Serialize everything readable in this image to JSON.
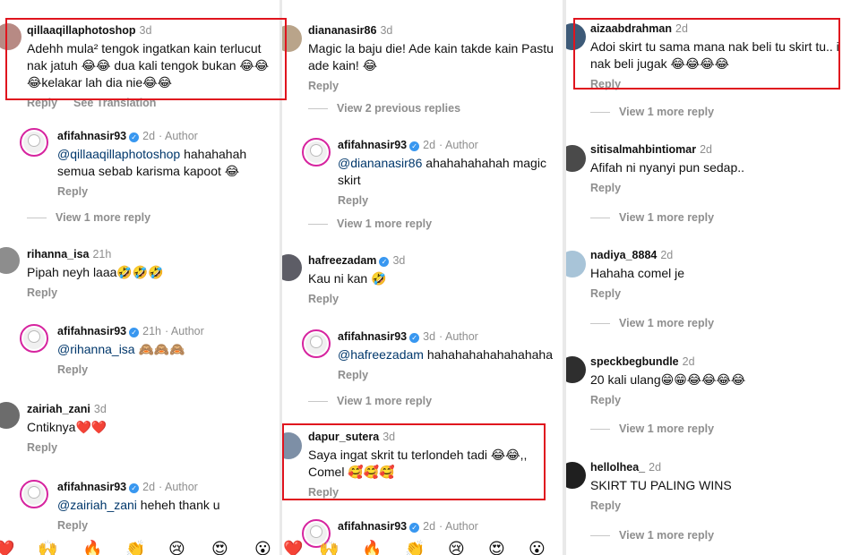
{
  "col1": {
    "c1": {
      "user": "qillaaqillaphotoshop",
      "ago": "3d",
      "text": "Adehh mula² tengok ingatkan kain terlucut nak jatuh 😂😂 dua kali tengok bukan 😂😂😂kelakar lah dia nie😂😂",
      "reply": "Reply",
      "translate": "See Translation"
    },
    "c2": {
      "user": "afifahnasir93",
      "ago": "2d",
      "author": "· Author",
      "mention": "@qillaaqillaphotoshop",
      "text": " hahahahah semua sebab karisma kapoot 😂",
      "reply": "Reply"
    },
    "more1": "View 1 more reply",
    "c3": {
      "user": "rihanna_isa",
      "ago": "21h",
      "text": "Pipah neyh laaa🤣🤣🤣",
      "reply": "Reply"
    },
    "c4": {
      "user": "afifahnasir93",
      "ago": "21h",
      "author": "· Author",
      "mention": "@rihanna_isa",
      "text": " 🙈🙈🙈",
      "reply": "Reply"
    },
    "c5": {
      "user": "zairiah_zani",
      "ago": "3d",
      "text": "Cntiknya❤️❤️",
      "reply": "Reply"
    },
    "c6": {
      "user": "afifahnasir93",
      "ago": "2d",
      "author": "· Author",
      "mention": "@zairiah_zani",
      "text": " heheh thank u",
      "reply": "Reply"
    }
  },
  "col2": {
    "c1": {
      "user": "diananasir86",
      "ago": "3d",
      "text": "Magic la baju die! Ade kain takde kain Pastu ade kain! 😂",
      "reply": "Reply"
    },
    "more0": "View 2 previous replies",
    "c2": {
      "user": "afifahnasir93",
      "ago": "2d",
      "author": "· Author",
      "mention": "@diananasir86",
      "text": " ahahahahahah magic skirt",
      "reply": "Reply"
    },
    "more1": "View 1 more reply",
    "c3": {
      "user": "hafreezadam",
      "ago": "3d",
      "text": "Kau ni kan 🤣",
      "reply": "Reply"
    },
    "c4": {
      "user": "afifahnasir93",
      "ago": "3d",
      "author": "· Author",
      "mention": "@hafreezadam",
      "text": " hahahahahahahahaha",
      "reply": "Reply"
    },
    "more2": "View 1 more reply",
    "c5": {
      "user": "dapur_sutera",
      "ago": "3d",
      "text": "Saya ingat skrit tu terlondeh tadi 😂😂,, Comel 🥰🥰🥰",
      "reply": "Reply"
    },
    "c6": {
      "user": "afifahnasir93",
      "ago": "2d",
      "author": "· Author"
    }
  },
  "col3": {
    "c1": {
      "user": "aizaabdrahman",
      "ago": "2d",
      "text": "Adoi skirt tu sama mana nak beli tu skirt tu.. i nak beli jugak 😂😂😂😂",
      "reply": "Reply"
    },
    "more1": "View 1 more reply",
    "c2": {
      "user": "sitisalmahbintiomar",
      "ago": "2d",
      "text": "Afifah ni nyanyi pun sedap..",
      "reply": "Reply"
    },
    "more2": "View 1 more reply",
    "c3": {
      "user": "nadiya_8884",
      "ago": "2d",
      "text": "Hahaha comel je",
      "reply": "Reply"
    },
    "more3": "View 1 more reply",
    "c4": {
      "user": "speckbegbundle",
      "ago": "2d",
      "text": "20 kali ulang😁😁😂😂😂😂",
      "reply": "Reply"
    },
    "more4": "View 1 more reply",
    "c5": {
      "user": "hellolhea_",
      "ago": "2d",
      "text": "SKIRT TU PALING WINS",
      "reply": "Reply"
    },
    "more5": "View 1 more reply"
  },
  "emoji_bar": [
    "❤️",
    "🙌",
    "🔥",
    "👏",
    "😢",
    "😍",
    "😮",
    "❤️",
    "🙌",
    "🔥",
    "👏",
    "😢",
    "😍",
    "😮"
  ],
  "accent": {
    "red_box": "#e0141e",
    "verified": "#3897f0",
    "mention": "#00376b",
    "muted": "#8e8e8e"
  }
}
